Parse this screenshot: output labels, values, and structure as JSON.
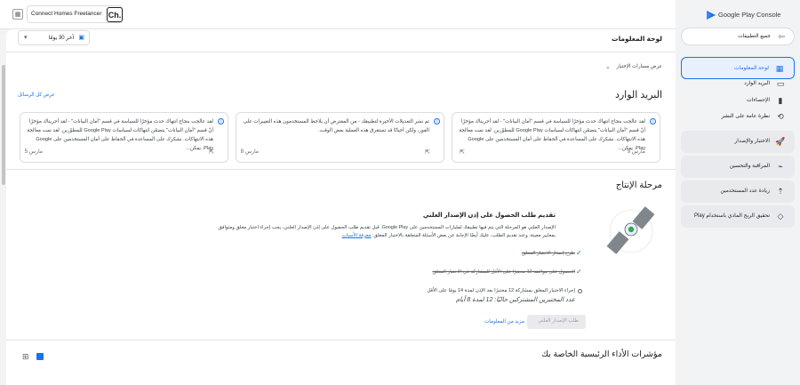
{
  "header": {
    "app_name": "Google Play Console",
    "account_name": "Connect Homes Freelancer",
    "account_initials": "Ch."
  },
  "sidebar": {
    "all_apps": "جميع التطبيقات",
    "items": [
      {
        "label": "لوحة المعلومات",
        "icon": "dashboard-icon"
      },
      {
        "label": "البريد الوارد",
        "icon": "inbox-icon"
      },
      {
        "label": "الإحصاءات",
        "icon": "bar-chart-icon"
      },
      {
        "label": "نظرة عامة على النشر",
        "icon": "publishing-icon"
      }
    ],
    "sections": [
      {
        "label": "الاختبار والإصدار",
        "icon": "rocket-icon"
      },
      {
        "label": "المراقبة والتحسين",
        "icon": "monitor-icon"
      },
      {
        "label": "زيادة عدد المستخدمين",
        "icon": "grow-icon"
      },
      {
        "label": "تحقيق الربح المادي باستخدام Play",
        "icon": "tag-icon"
      }
    ]
  },
  "dashboard": {
    "title": "لوحة المعلومات",
    "date_filter": "آخر 30 يومًا",
    "show_paths": "عرض مسارات الإختبار",
    "inbox_title": "البريد الوارد",
    "view_all": "عرض كل الرسائل",
    "messages": [
      {
        "text": "لقد عالجت بنجاح انتهاك حدث مؤخرًا للسياسة في قسم \"أمان البيانات\" - لقد أجريناك مؤخرًا أنّ قسم \"أمان البيانات\" يتضمّن انتهاكات لسياسات Google Play للمطوّرين. لقد تمت معالجة هذه الانتهاكات. نشكرك على المساعدة في الحفاظ على أمان المستخدمين على Google Play. يمكن...",
        "date": "9 مارس"
      },
      {
        "text": "تم نشر التعديلات الأخيرة لتطبيقك - من المفترض أن يلاحظ المستخدمون هذه التغييرات على الفور، ولكن أحيانًا قد تستغرق هذه العملية بعض الوقت.",
        "date": "8 مارس"
      },
      {
        "text": "لقد عالجت بنجاح انتهاك حدث مؤخرًا للسياسة في قسم \"أمان البيانات\" - لقد أجريناك مؤخرًا أنّ قسم \"أمان البيانات\" يتضمّن انتهاكات لسياسات Google Play للمطوّرين. لقد تمت معالجة هذه الانتهاكات. نشكرك على المساعدة في الحفاظ على أمان المستخدمين على Google Play. يمكن...",
        "date": "5 مارس"
      }
    ],
    "production_title": "مرحلة الإنتاج",
    "production_subtitle": "تقديم طلب الحصول على إذن الإصدار العلني",
    "production_desc": "الإصدار العلني هو المرحلة التي يتم فيها تطبيقك لمليارات المستخدمين على Google Play. قبل تقديم طلب الحصول على إذن الإصدار العلني، يجب إجراء اختبار مغلق ومتوافق بمعايير معينة، وعند تقديم الطلب، عليك أيضًا الإجابة عن بعض الأسئلة المتعلقة بالاختبار المغلق.",
    "production_link": "معرفة الأسباب",
    "checklist": [
      {
        "text": "طرح إصدار الاختبار المغلق",
        "done": true
      },
      {
        "text": "الحصول على موافقة 12 مختبرًا على الأقل للمشاركة في الاختبار المغلق",
        "done": true
      },
      {
        "text": "إجراء الاختبار المغلق بمشاركة 12 مختبرًا بعد الإذن لمدة 14 يومًا على الأقل",
        "done": false
      }
    ],
    "checklist_note": "عدد المختبرين المشتركين حاليًا: 12 لمدة 8 أيام",
    "apply_button": "طلب الإصدار العلني",
    "more_info": "مزيد من المعلومات",
    "kpi_title": "مؤشرات الأداء الرئيسية الخاصة بك"
  },
  "colors": {
    "accent": "#1a73e8",
    "selected_bg": "#e8f0fe",
    "success": "#188038"
  }
}
